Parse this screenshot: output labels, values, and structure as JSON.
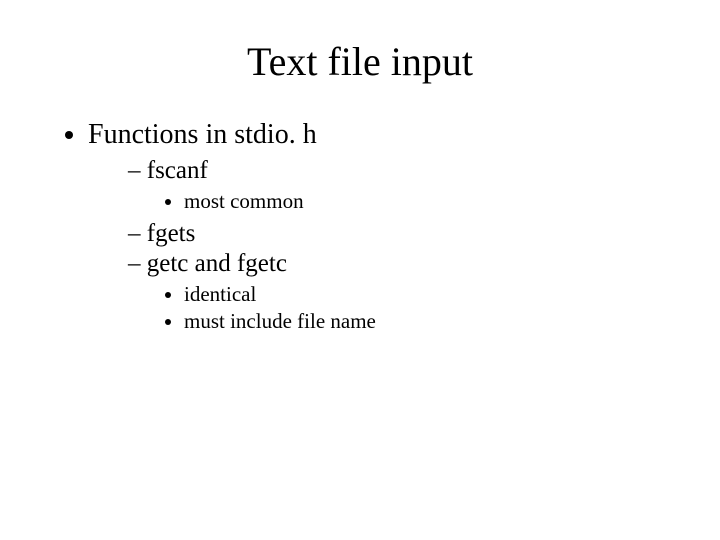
{
  "title": "Text file input",
  "b1": "Functions in stdio. h",
  "d1": "fscanf",
  "s1": "most common",
  "d2": "fgets",
  "d3": "getc and fgetc",
  "s2": "identical",
  "s3": "must include file name"
}
